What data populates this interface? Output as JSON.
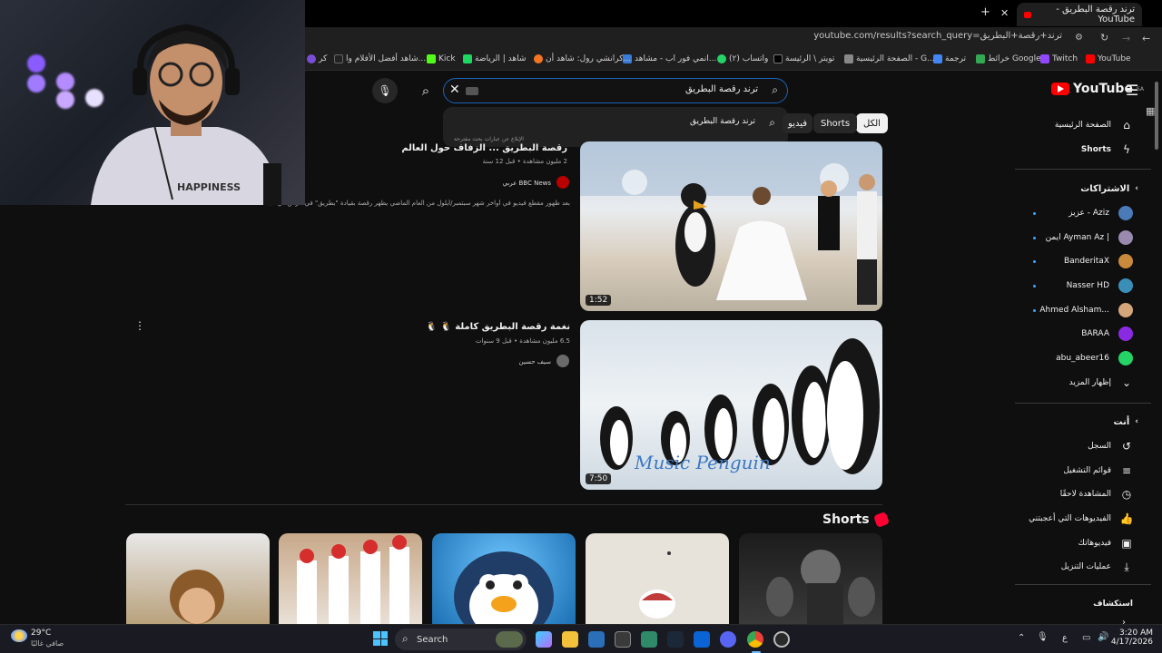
{
  "browser": {
    "tabs": [
      {
        "label": "ترند رقصة البطريق - YouTube"
      }
    ],
    "new_tab_label": "+",
    "url": "youtube.com/results?search_query=ترند+رقصة+البطريق",
    "bookmarks": [
      "YouTube",
      "Twitch",
      "خرائط Google",
      "ترجمة",
      "الصفحة الرئيسية - G...",
      "تويتر \\ الرئيسة",
      "(٢) واتساب",
      "انمي فور اب - مشاهد...",
      "كرانشي رول: شاهد أن...",
      "شاهد | الرياضة",
      "Kick",
      "شاهد أفضل الأفلام وا...",
      "كر"
    ]
  },
  "youtube": {
    "logo_text": "YouTube",
    "logo_region": "SA",
    "search": {
      "query": "ترند رقصة البطريق",
      "suggestion": "ترند رقصة البطريق",
      "report_text": "الإبلاغ عن عبارات بحث مقترحة"
    },
    "chips": [
      "الكل",
      "Shorts",
      "فيديو"
    ],
    "sidebar": {
      "main": [
        {
          "label": "الصفحة الرئيسية",
          "icon": "home-icon"
        },
        {
          "label": "Shorts",
          "icon": "shorts-icon"
        }
      ],
      "subscriptions_header": "الاشتراكات",
      "subscriptions": [
        {
          "label": "عزيز - Aziz",
          "color": "#4a7ab8"
        },
        {
          "label": "ايمن Ayman Az |",
          "color": "#9b8ab0"
        },
        {
          "label": "BanderitaX",
          "color": "#c98a3b"
        },
        {
          "label": "Nasser HD",
          "color": "#3a8fb8"
        },
        {
          "label": "Ahmed Alsham...",
          "color": "#d4a77a"
        },
        {
          "label": "BARAA",
          "color": "#8a2be2"
        },
        {
          "label": "abu_abeer16",
          "color": "#25d366"
        }
      ],
      "show_more": "إظهار المزيد",
      "you_header": "أنت",
      "you_items": [
        {
          "label": "السجل",
          "icon": "history-icon"
        },
        {
          "label": "قوائم التشغيل",
          "icon": "playlists-icon"
        },
        {
          "label": "المشاهدة لاحقًا",
          "icon": "watch-later-icon"
        },
        {
          "label": "الفيديوهات التي أعجبتني",
          "icon": "like-icon"
        },
        {
          "label": "فيديوهاتك",
          "icon": "your-videos-icon"
        },
        {
          "label": "عمليات التنزيل",
          "icon": "download-icon"
        }
      ],
      "explore_header": "استكشاف"
    },
    "results": [
      {
        "title": "رقصة البطريق ... الزفاف حول العالم",
        "meta": "2 مليون مشاهدة • قبل 12 سنة",
        "channel": "BBC News عربي",
        "description": "بعد ظهور مقطع فيديو في أواخر شهر سبتمبر/أيلول من العام الماضي يظهر رقصة بقيادة \"بطريق\" في عرس في البلاد",
        "duration": "1:52"
      },
      {
        "title": "نغمة رقصة البطريق كاملة 🐧 🐧",
        "meta": "6.5 مليون مشاهدة • قبل 9 سنوات",
        "channel": "سيف حسين",
        "duration": "7:50",
        "overlay_text": "Music Penguin"
      }
    ],
    "shorts_label": "Shorts"
  },
  "taskbar": {
    "weather_temp": "29°C",
    "weather_desc": "صافي غالبًا",
    "search_label": "Search",
    "time": "3:20 AM",
    "date": "4/17/2026",
    "lang": "ع"
  }
}
